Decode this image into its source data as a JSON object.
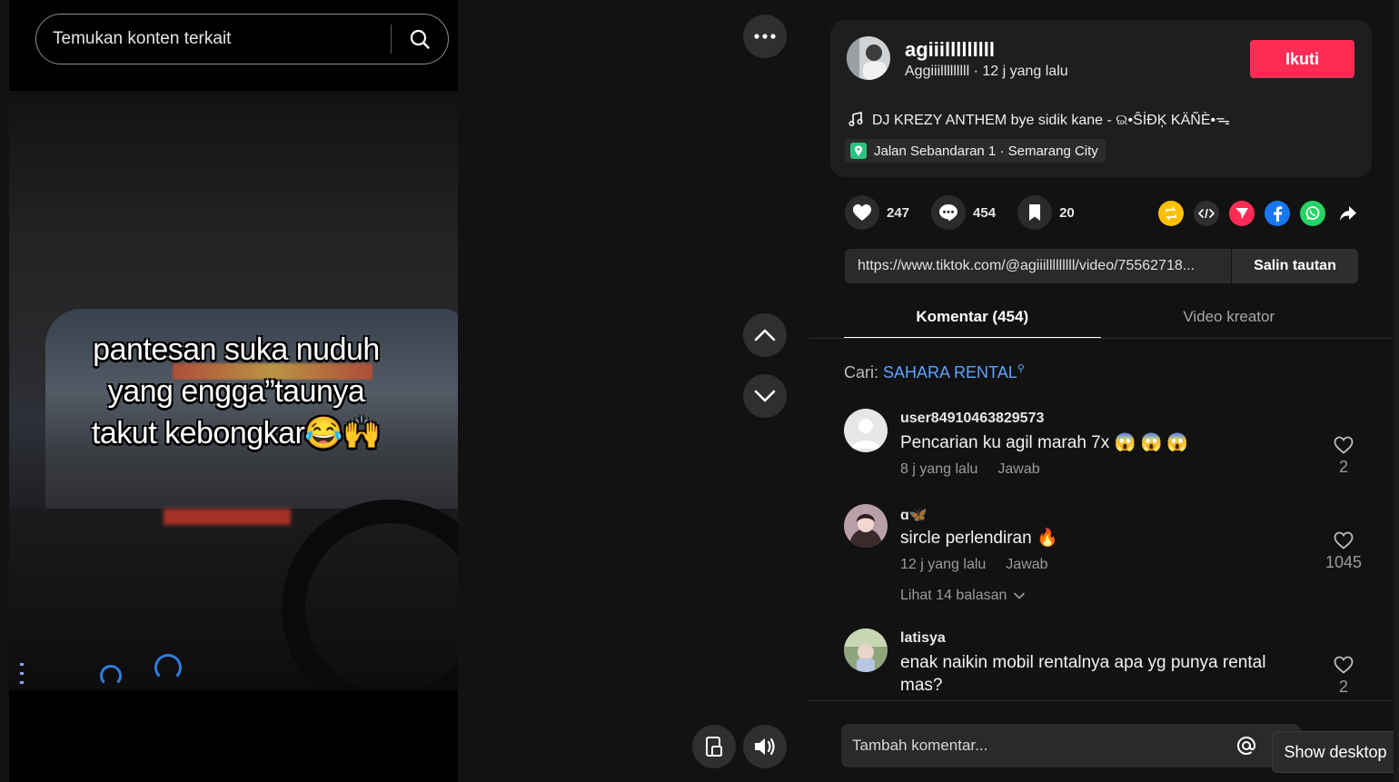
{
  "search": {
    "placeholder": "Temukan konten terkait"
  },
  "video": {
    "caption_lines": [
      "pantesan suka nuduh",
      "yang engga”taunya",
      "takut kebongkar😂🙌"
    ]
  },
  "author": {
    "username": "agiiilllllllll",
    "nickname": "Aggiiilllllllll",
    "time_ago": "12 j yang lalu",
    "follow_label": "Ikuti",
    "music": "DJ KREZY ANTHEM bye sidik kane - ଇ•ŜİĐĶ KÄÑÈ•ᯓ",
    "location": "Jalan Sebandaran 1 · Semarang City"
  },
  "stats": {
    "likes": "247",
    "comments": "454",
    "saves": "20"
  },
  "share_link": {
    "url": "https://www.tiktok.com/@agiiilllllllll/video/75562718...",
    "copy_label": "Salin tautan"
  },
  "tabs": [
    {
      "label": "Komentar (454)",
      "active": true
    },
    {
      "label": "Video kreator",
      "active": false
    }
  ],
  "search_hint": {
    "prefix": "Cari: ",
    "term": "SAHARA RENTAL"
  },
  "comments": [
    {
      "user": "user84910463829573",
      "text": "Pencarian ku agil marah 7x 😱 😱 😱",
      "time": "8 j yang lalu",
      "reply": "Jawab",
      "likes": "2"
    },
    {
      "user": "ɑ🦋",
      "text": "sircle perlendiran 🔥",
      "time": "12 j yang lalu",
      "reply": "Jawab",
      "likes": "1045",
      "view_replies": "Lihat 14 balasan"
    },
    {
      "user": "latisya",
      "text": "enak naikin mobil rentalnya apa yg punya rental mas?",
      "likes": "2"
    }
  ],
  "comment_bar": {
    "placeholder": "Tambah komentar..."
  },
  "show_desktop": "Show desktop",
  "colors": {
    "accent": "#fe2c55",
    "link": "#5ea3ff",
    "background": "#121212"
  }
}
